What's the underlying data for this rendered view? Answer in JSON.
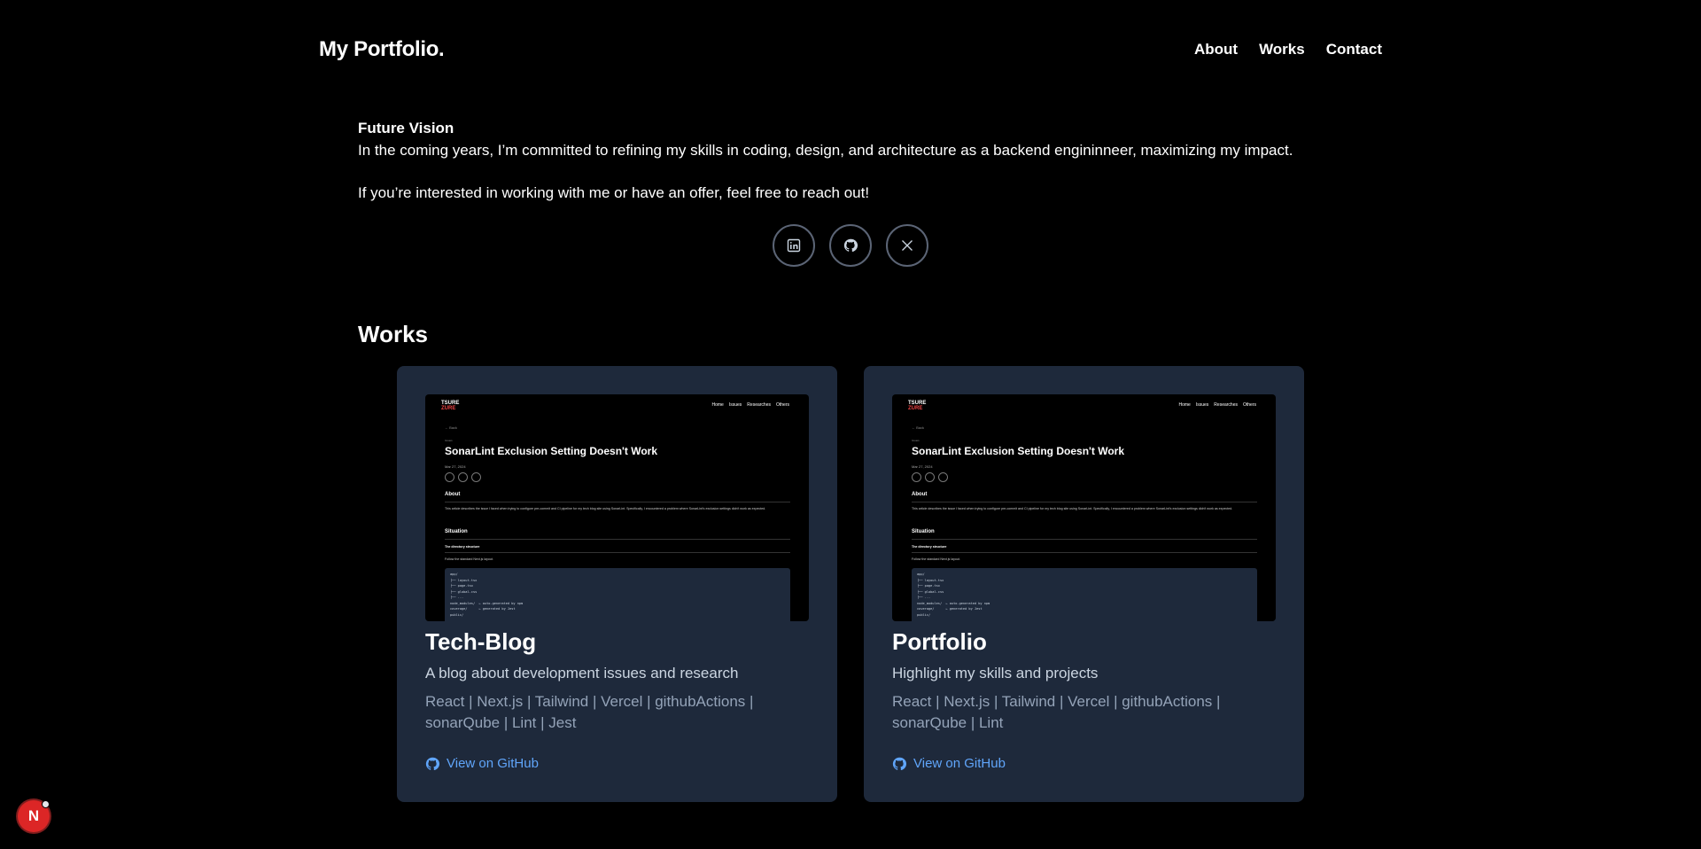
{
  "header": {
    "logo": "My Portfolio.",
    "nav": [
      "About",
      "Works",
      "Contact"
    ]
  },
  "vision": {
    "title": "Future Vision",
    "text": "In the coming years, I’m committed to refining my skills in coding, design, and architecture as a backend engininneer, maximizing my impact.",
    "cta": "If you’re interested in working with me or have an offer, feel free to reach out!"
  },
  "socials": [
    {
      "name": "linkedin",
      "icon": "linkedin-icon"
    },
    {
      "name": "github",
      "icon": "github-icon"
    },
    {
      "name": "x",
      "icon": "x-icon"
    }
  ],
  "works": {
    "heading": "Works",
    "cards": [
      {
        "title": "Tech-Blog",
        "description": "A blog about development issues and research",
        "tags": "React | Next.js | Tailwind | Vercel | githubActions | sonarQube | Lint | Jest",
        "link_label": "View on GitHub"
      },
      {
        "title": "Portfolio",
        "description": "Highlight my skills and projects",
        "tags": "React | Next.js | Tailwind | Vercel | githubActions | sonarQube | Lint",
        "link_label": "View on GitHub"
      }
    ],
    "thumbnail": {
      "logo_top": "TSURE",
      "logo_bottom": "ZURE",
      "nav": [
        "Home",
        "Issues",
        "Researches",
        "Others"
      ],
      "back": "← Back",
      "category": "Issues",
      "title": "SonarLint Exclusion Setting Doesn't Work",
      "date": "Mar 27, 2024",
      "about_heading": "About",
      "about_text": "This article describes the issue I faced when trying to configure pre-commit and CI pipeline for my tech blog site using SonarLint. Specifically, I encountered a problem where SonarLint's exclusion settings didn't work as expected.",
      "situation_heading": "Situation",
      "dir_heading": "The directory structure",
      "dir_text": "Follow the standard Next.js layout.",
      "code": "app/\n├── layout.tsx\n├── page.tsx\n├── global.css\n├── ...\nnode_modules/  ← auto-generated by npm\ncoverage/      ← generated by Jest\npublic/"
    }
  },
  "badge": {
    "label": "N"
  },
  "colors": {
    "background": "#000000",
    "card": "#1e293b",
    "link": "#60a5fa",
    "tags": "#94a3b8",
    "badge": "#dc2626"
  }
}
